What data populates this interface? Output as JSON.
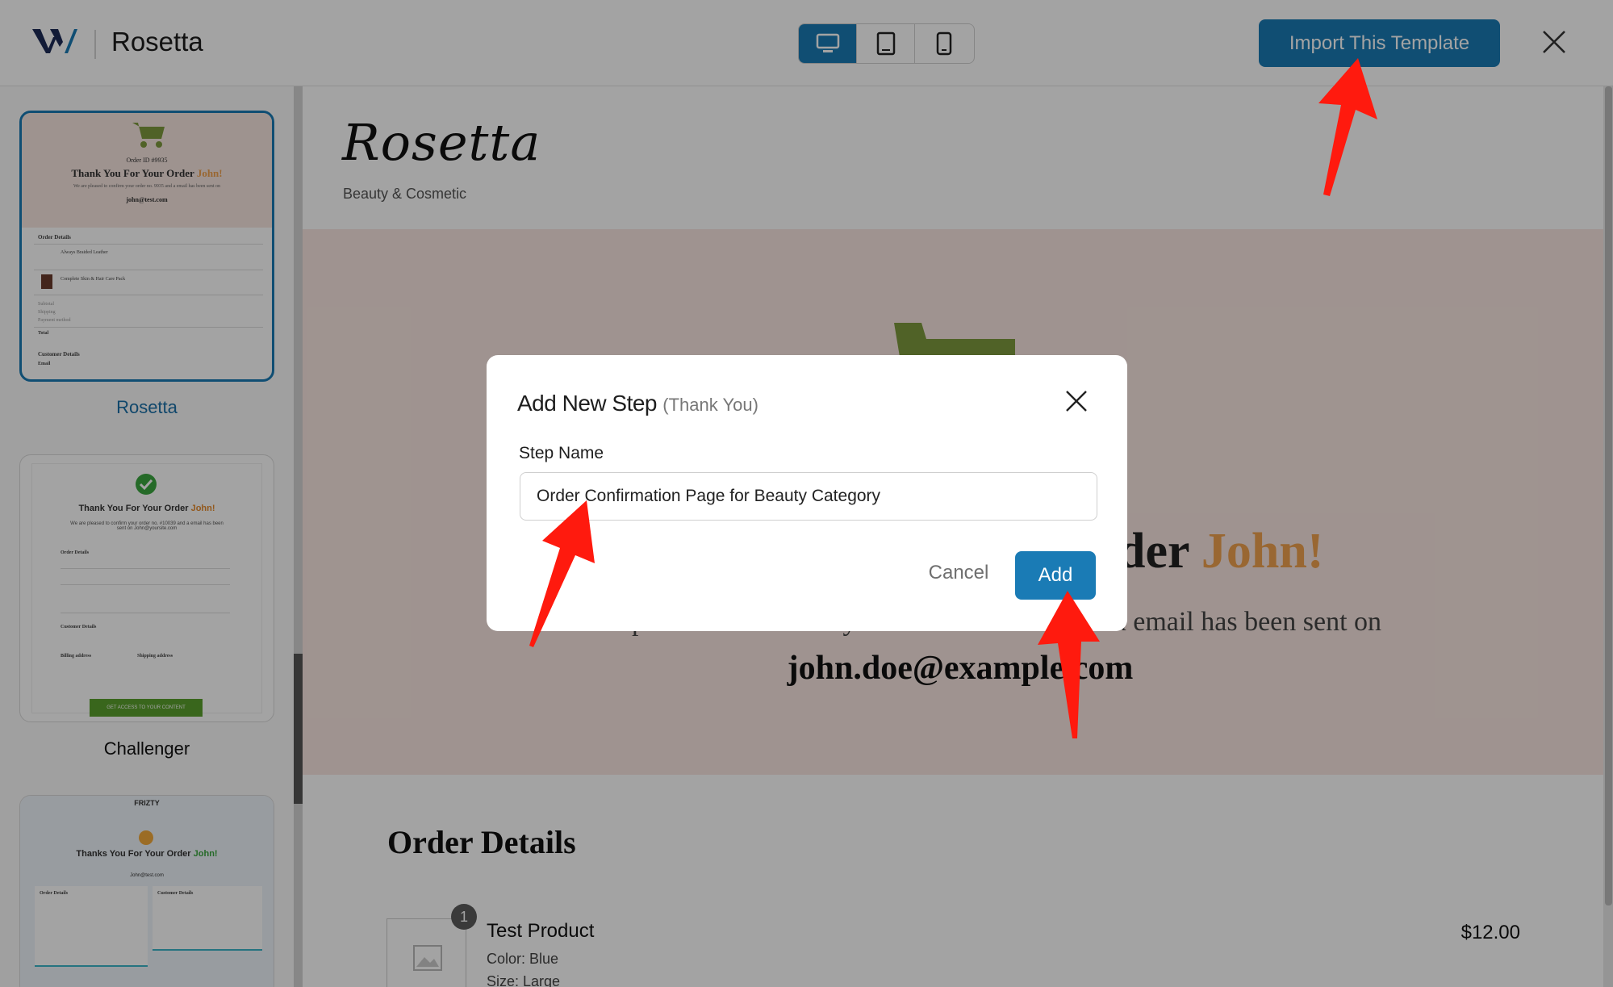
{
  "app": {
    "title": "Rosetta",
    "import_label": "Import This Template"
  },
  "device_toggle": {
    "items": [
      {
        "icon": "desktop-icon",
        "active": true
      },
      {
        "icon": "tablet-icon",
        "active": false
      },
      {
        "icon": "mobile-icon",
        "active": false
      }
    ]
  },
  "sidebar": {
    "templates": [
      {
        "name": "Rosetta",
        "selected": true,
        "preview": {
          "order_id": "Order ID #9935",
          "heading": "Thank You For Your Order",
          "heading_name": "John!",
          "line": "We are pleased to confirm your order no. 9935 and a email has been sent on",
          "email": "john@test.com",
          "order_details": "Order Details",
          "item1": "Always Braided Leather",
          "item2": "Complete Skin & Hair Care Pack",
          "subtotal": "Subtotal",
          "shipping": "Shipping",
          "payment": "Payment method",
          "total": "Total",
          "customer_details": "Customer Details",
          "email_label": "Email"
        }
      },
      {
        "name": "Challenger",
        "selected": false,
        "preview": {
          "heading": "Thank You For Your Order",
          "heading_name": "John!",
          "line": "We are pleased to confirm your order no. #10039 and a email has been sent on John@yoursite.com",
          "order_details": "Order Details",
          "customer_details": "Customer Details",
          "billing": "Billing address",
          "shipping_addr": "Shipping address",
          "cta": "GET ACCESS TO YOUR CONTENT"
        }
      },
      {
        "name": "Frizty",
        "selected": false,
        "preview": {
          "brand": "FRIZTY",
          "heading": "Thanks You For Your Order",
          "heading_name": "John!",
          "email": "John@test.com",
          "order_details": "Order Details",
          "customer_details": "Customer Details"
        }
      }
    ]
  },
  "preview": {
    "brand": "Rosetta",
    "brand_sub": "Beauty & Cosmetic",
    "hero_title_visible": "der",
    "hero_title_name": "John!",
    "hero_line_visible": "We are pleased to confirm your order no. 9935 and a email has been sent on",
    "hero_email": "john.doe@example.com",
    "order_details_title": "Order Details",
    "product": {
      "qty": "1",
      "name": "Test Product",
      "color": "Color: Blue",
      "size": "Size: Large",
      "price": "$12.00"
    }
  },
  "modal": {
    "title": "Add New Step",
    "subtitle": "(Thank You)",
    "field_label": "Step Name",
    "field_value": "Order Confirmation Page for Beauty Category",
    "cancel_label": "Cancel",
    "add_label": "Add"
  },
  "colors": {
    "accent": "#1a7bb5",
    "hero_bg": "#f9e7e1",
    "arrow": "#ff1a0e",
    "cart": "#7d9a3e",
    "highlight_name": "#f0a24f"
  }
}
